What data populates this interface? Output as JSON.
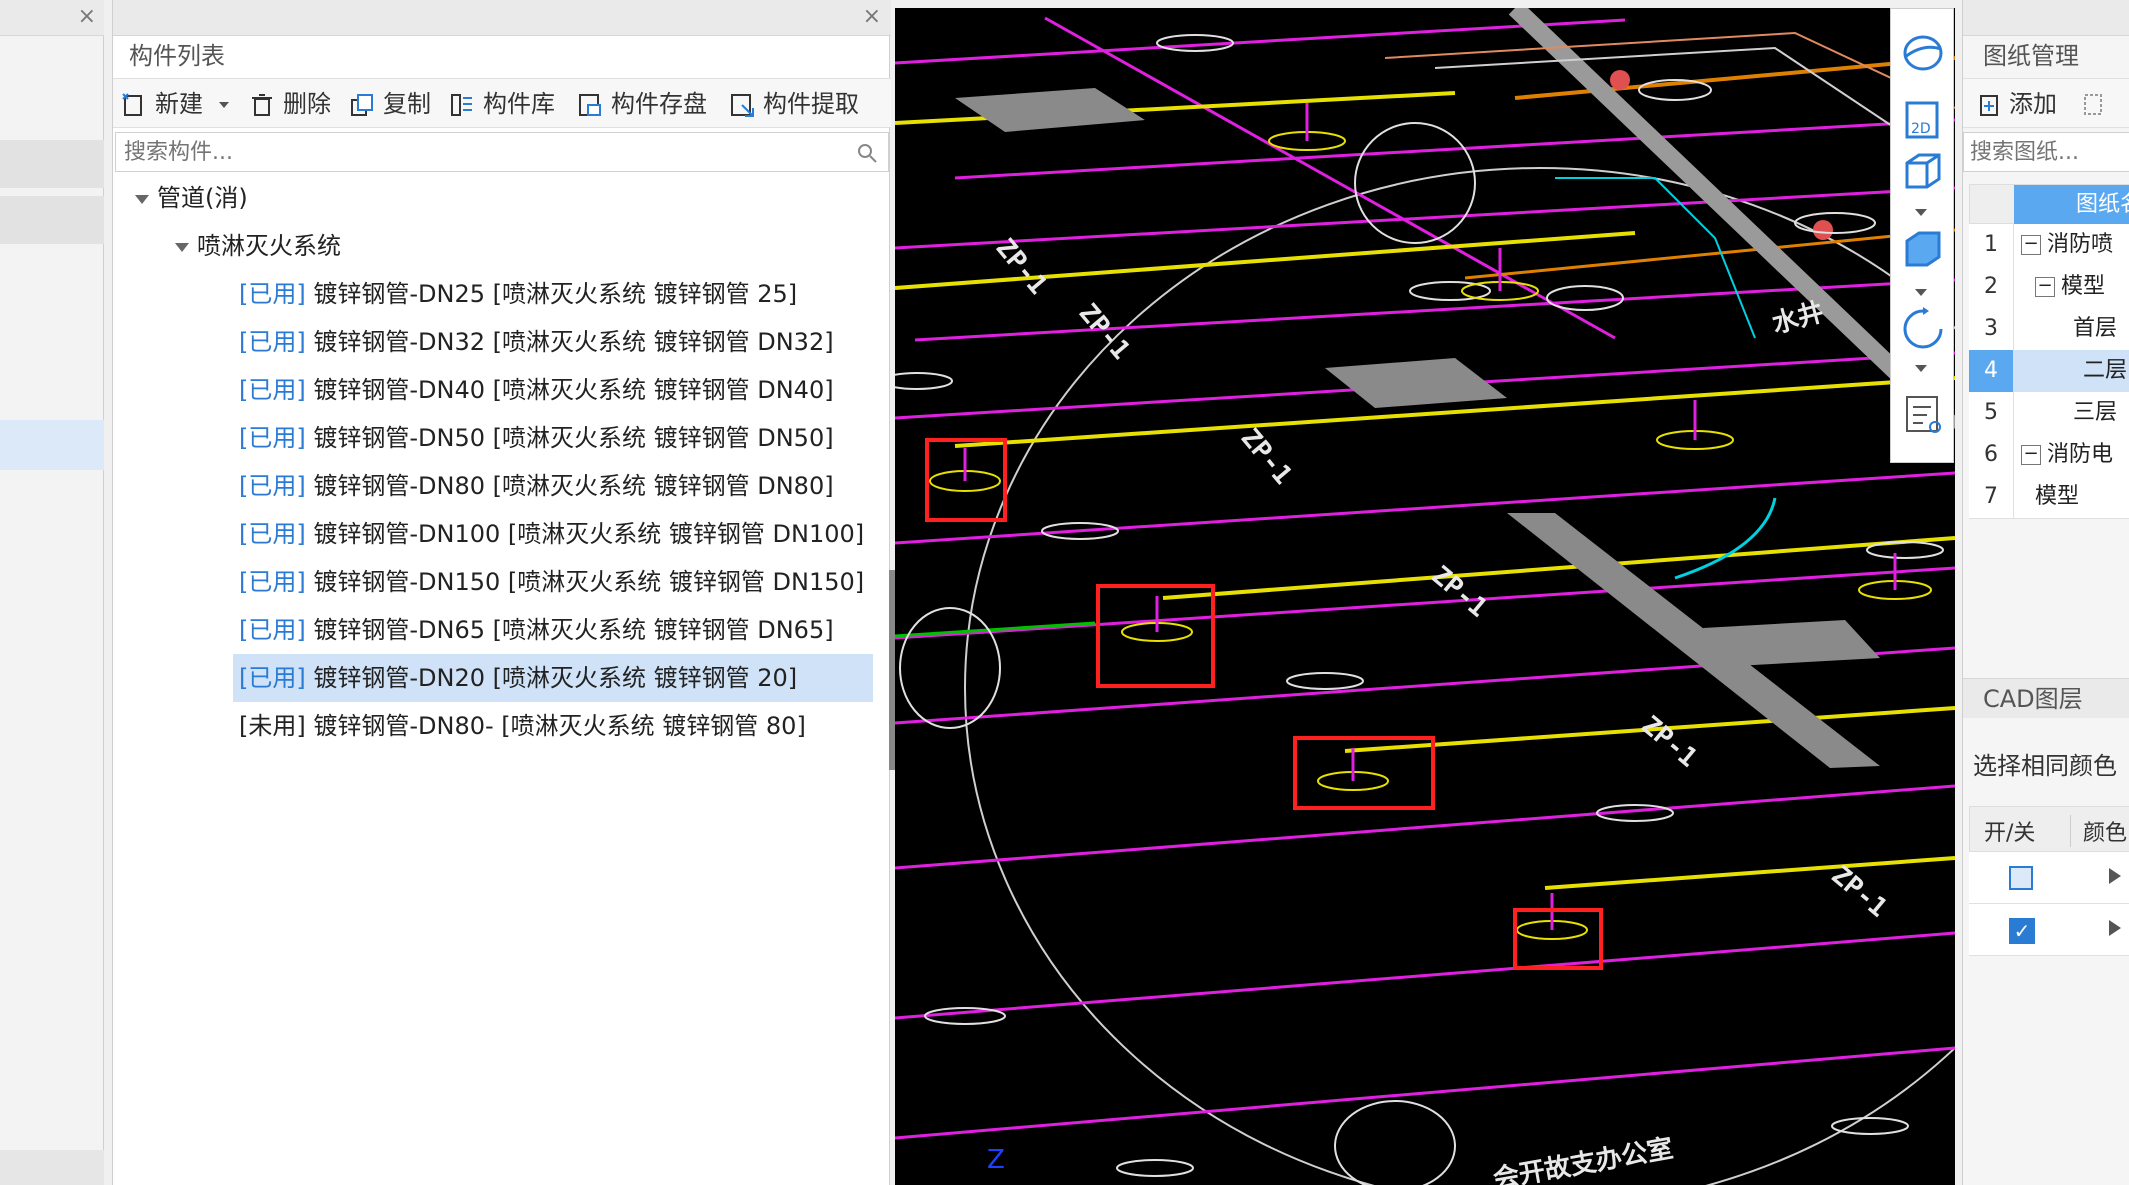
{
  "left_panel": {
    "close_label": "×"
  },
  "component_list": {
    "close_label": "×",
    "title": "构件列表",
    "toolbar": {
      "new_label": "新建",
      "delete_label": "删除",
      "copy_label": "复制",
      "library_label": "构件库",
      "save_label": "构件存盘",
      "extract_label": "构件提取"
    },
    "search_placeholder": "搜索构件...",
    "tree": {
      "root_label": "管道(消)",
      "group_label": "喷淋灭火系统",
      "items": [
        {
          "status": "[已用]",
          "label": " 镀锌钢管-DN25 [喷淋灭火系统 镀锌钢管 25]",
          "used": true
        },
        {
          "status": "[已用]",
          "label": " 镀锌钢管-DN32 [喷淋灭火系统 镀锌钢管 DN32]",
          "used": true
        },
        {
          "status": "[已用]",
          "label": " 镀锌钢管-DN40 [喷淋灭火系统 镀锌钢管 DN40]",
          "used": true
        },
        {
          "status": "[已用]",
          "label": " 镀锌钢管-DN50 [喷淋灭火系统 镀锌钢管 DN50]",
          "used": true
        },
        {
          "status": "[已用]",
          "label": " 镀锌钢管-DN80 [喷淋灭火系统 镀锌钢管 DN80]",
          "used": true
        },
        {
          "status": "[已用]",
          "label": " 镀锌钢管-DN100 [喷淋灭火系统 镀锌钢管 DN100]",
          "used": true
        },
        {
          "status": "[已用]",
          "label": " 镀锌钢管-DN150 [喷淋灭火系统 镀锌钢管 DN150]",
          "used": true
        },
        {
          "status": "[已用]",
          "label": " 镀锌钢管-DN65 [喷淋灭火系统 镀锌钢管 DN65]",
          "used": true
        },
        {
          "status": "[已用]",
          "label": " 镀锌钢管-DN20 [喷淋灭火系统 镀锌钢管 20]",
          "used": true,
          "selected": true
        },
        {
          "status": "[未用]",
          "label": " 镀锌钢管-DN80- [喷淋灭火系统 镀锌钢管 80]",
          "used": false
        }
      ]
    }
  },
  "cad_view": {
    "axis_label": "Z",
    "text_marks": [
      "ZP-1",
      "ZP-1",
      "ZP-1",
      "ZP-1",
      "ZP-1",
      "ZP-1"
    ],
    "note_text": "水井",
    "bottom_text": "会开故支办公室",
    "colors": {
      "background": "#000000",
      "magenta": "#e020e0",
      "yellow": "#e8e000",
      "orange": "#e08000",
      "white": "#e0e0e0",
      "cyan": "#00d0e0",
      "red_box": "#ff2020",
      "green": "#00c000",
      "gray": "#8a8a8a"
    }
  },
  "view_toolbar": {
    "icons": [
      "orbit-icon",
      "2d-view-icon",
      "3d-box-icon",
      "solid-box-icon",
      "rotate-icon",
      "layer-list-icon"
    ]
  },
  "right_panel": {
    "drawing_title": "图纸管理",
    "add_label": "添加",
    "search_placeholder": "搜索图纸...",
    "table_header": "图纸名",
    "rows": [
      {
        "num": "1",
        "label": "消防喷",
        "expand": "−"
      },
      {
        "num": "2",
        "label": "模型",
        "expand": "−"
      },
      {
        "num": "3",
        "label": "首层",
        "expand": ""
      },
      {
        "num": "4",
        "label": "二层",
        "expand": "",
        "selected": true
      },
      {
        "num": "5",
        "label": "三层",
        "expand": ""
      },
      {
        "num": "6",
        "label": "消防电",
        "expand": "−"
      },
      {
        "num": "7",
        "label": "模型",
        "expand": ""
      }
    ],
    "cad_layer_title": "CAD图层",
    "select_same_color": "选择相同颜色",
    "layer_col_switch": "开/关",
    "layer_col_color": "颜色"
  }
}
